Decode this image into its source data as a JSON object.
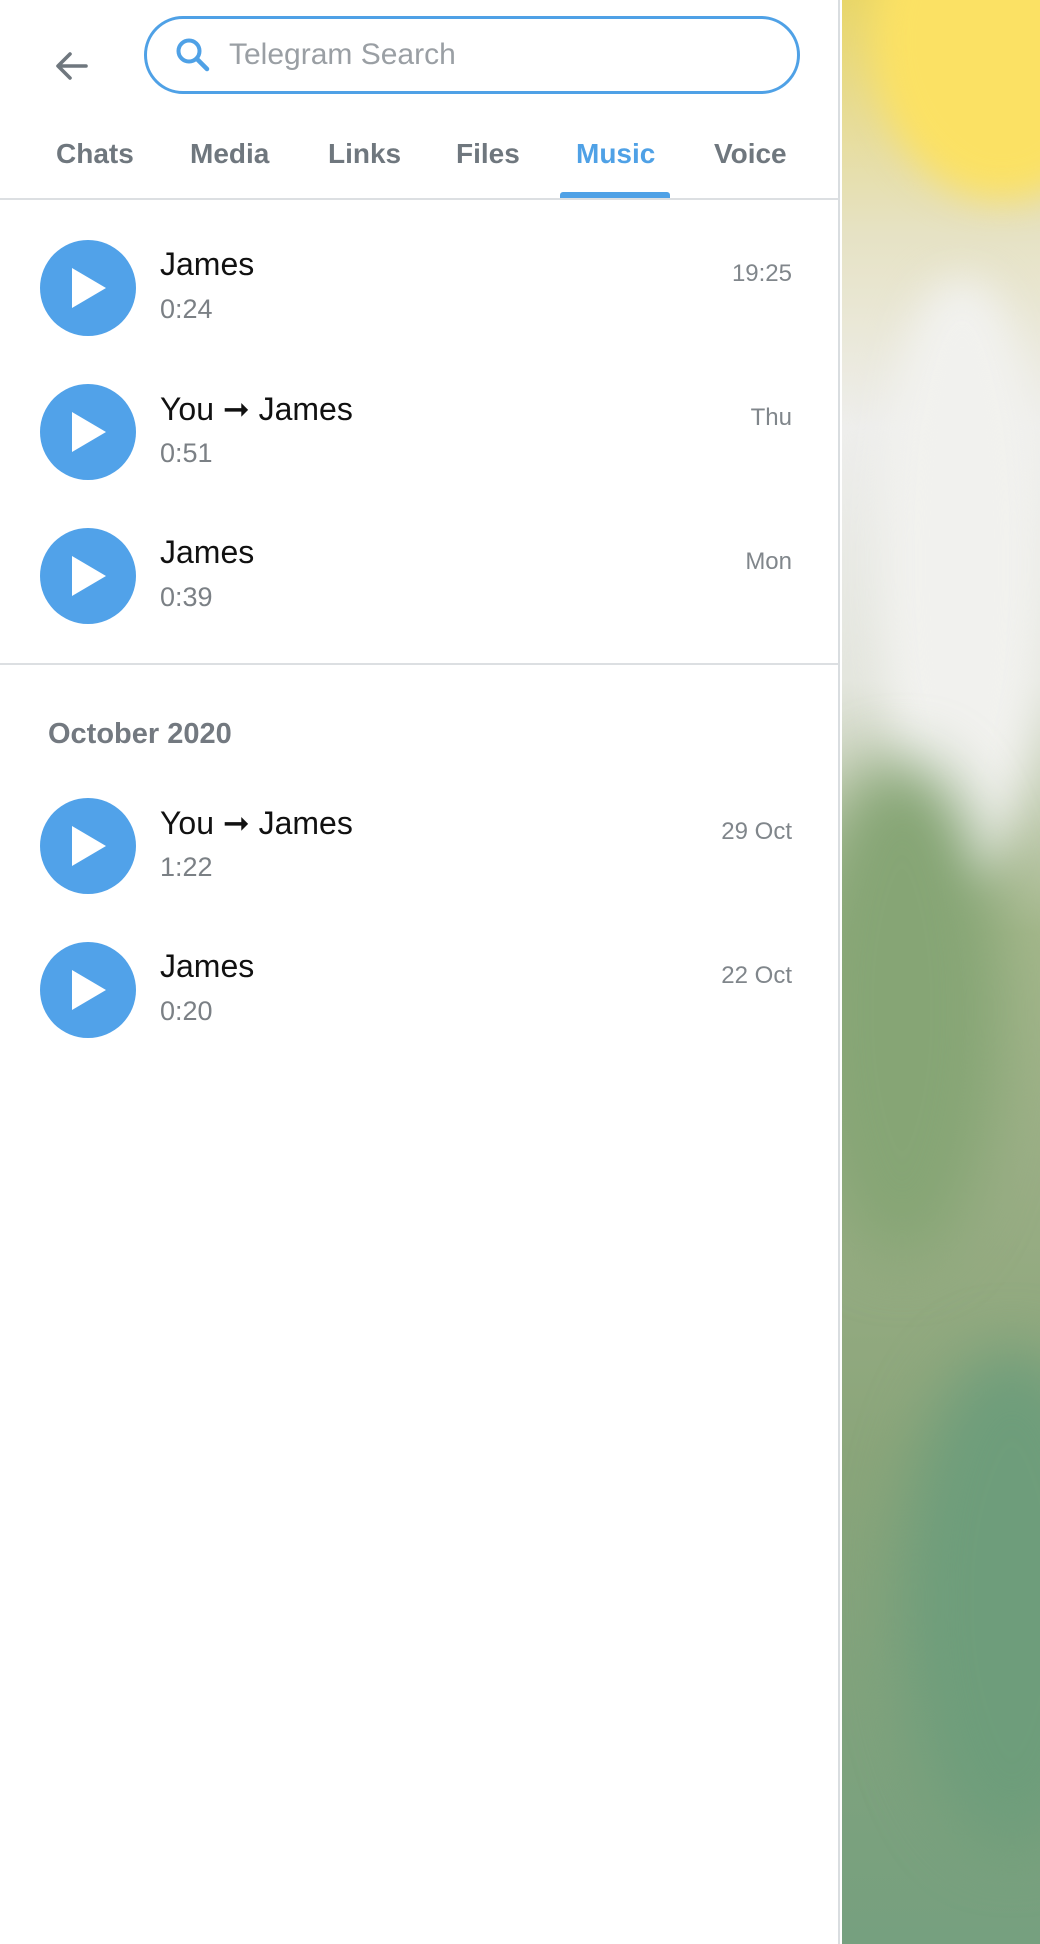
{
  "search": {
    "placeholder": "Telegram Search",
    "value": ""
  },
  "tabs": [
    {
      "label": "Chats",
      "active": false
    },
    {
      "label": "Media",
      "active": false
    },
    {
      "label": "Links",
      "active": false
    },
    {
      "label": "Files",
      "active": false
    },
    {
      "label": "Music",
      "active": true
    },
    {
      "label": "Voice",
      "active": false
    }
  ],
  "recent_items": [
    {
      "title": "James",
      "duration": "0:24",
      "date": "19:25"
    },
    {
      "title": "You ➞ James",
      "duration": "0:51",
      "date": "Thu"
    },
    {
      "title": "James",
      "duration": "0:39",
      "date": "Mon"
    }
  ],
  "section": {
    "header": "October 2020",
    "items": [
      {
        "title": "You ➞ James",
        "duration": "1:22",
        "date": "29 Oct"
      },
      {
        "title": "James",
        "duration": "0:20",
        "date": "22 Oct"
      }
    ]
  },
  "icons": {
    "back": "arrow-left-icon",
    "search": "search-icon",
    "play": "play-icon"
  },
  "colors": {
    "accent": "#4fa1e6",
    "play_button": "#51a2e9",
    "inactive_tab": "#6f777e"
  }
}
